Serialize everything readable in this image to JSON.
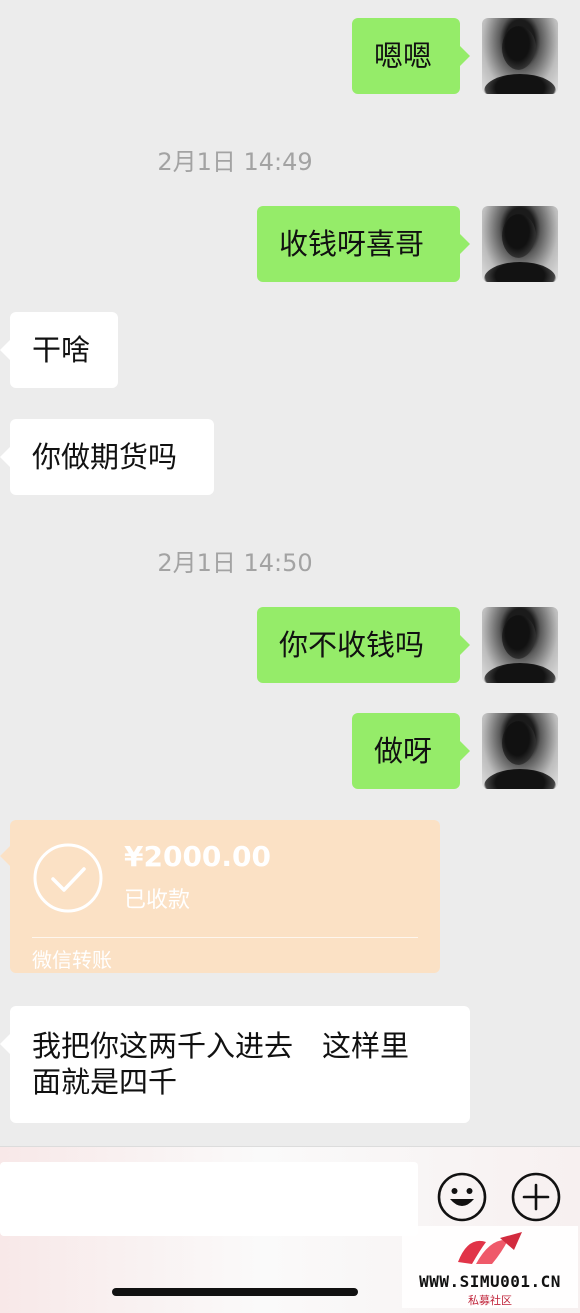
{
  "messages": [
    {
      "dir": "out",
      "text": "嗯嗯"
    },
    {
      "type": "time",
      "text": "2月1日 14:49"
    },
    {
      "dir": "out",
      "text": "收钱呀喜哥"
    },
    {
      "dir": "in",
      "text": "干啥"
    },
    {
      "dir": "in",
      "text": "你做期货吗"
    },
    {
      "type": "time",
      "text": "2月1日 14:50"
    },
    {
      "dir": "out",
      "text": "你不收钱吗"
    },
    {
      "dir": "out",
      "text": "做呀"
    },
    {
      "dir": "in",
      "text_line1": "我把你这两千入进去　这样里",
      "text_line2": "面就是四千"
    }
  ],
  "transfer": {
    "amount": "¥2000.00",
    "status": "已收款",
    "footer": "微信转账"
  },
  "input_bar": {
    "emoji_icon": "emoji-icon",
    "plus_icon": "plus-icon"
  },
  "watermark": {
    "text": "WWW.SIMU001.CN",
    "sub": "私募社区"
  },
  "colors": {
    "outgoing_bubble": "#95ec69",
    "incoming_bubble": "#ffffff",
    "transfer_bg": "#fbe1c5",
    "background": "#ececec"
  }
}
